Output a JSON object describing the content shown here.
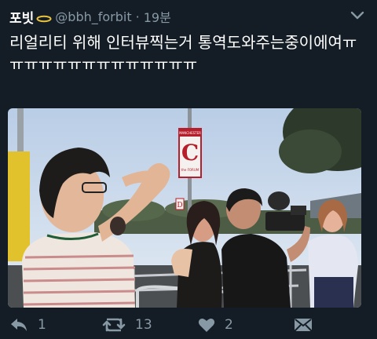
{
  "tweet": {
    "author_name": "포빗",
    "handle": "@bbh_forbit",
    "separator": "·",
    "time": "19분",
    "text": "리얼리티 위해 인터뷰찍는거 통역도와주는중이에여ㅠㅠㅠㅠㅠㅠㅠㅠㅠㅠㅠㅠㅠㅠ"
  },
  "media": {
    "sign_title": "MANCHESTER",
    "sign_letter": "C",
    "sign_sub": "the FORUM",
    "small_sign": "D"
  },
  "actions": {
    "reply_count": "1",
    "retweet_count": "13",
    "like_count": "2"
  },
  "colors": {
    "background": "#141d26",
    "muted": "#8899a6",
    "text": "#ffffff"
  },
  "icons": [
    "halo-icon",
    "caret-down-icon",
    "reply-icon",
    "retweet-icon",
    "heart-icon",
    "direct-message-icon"
  ]
}
